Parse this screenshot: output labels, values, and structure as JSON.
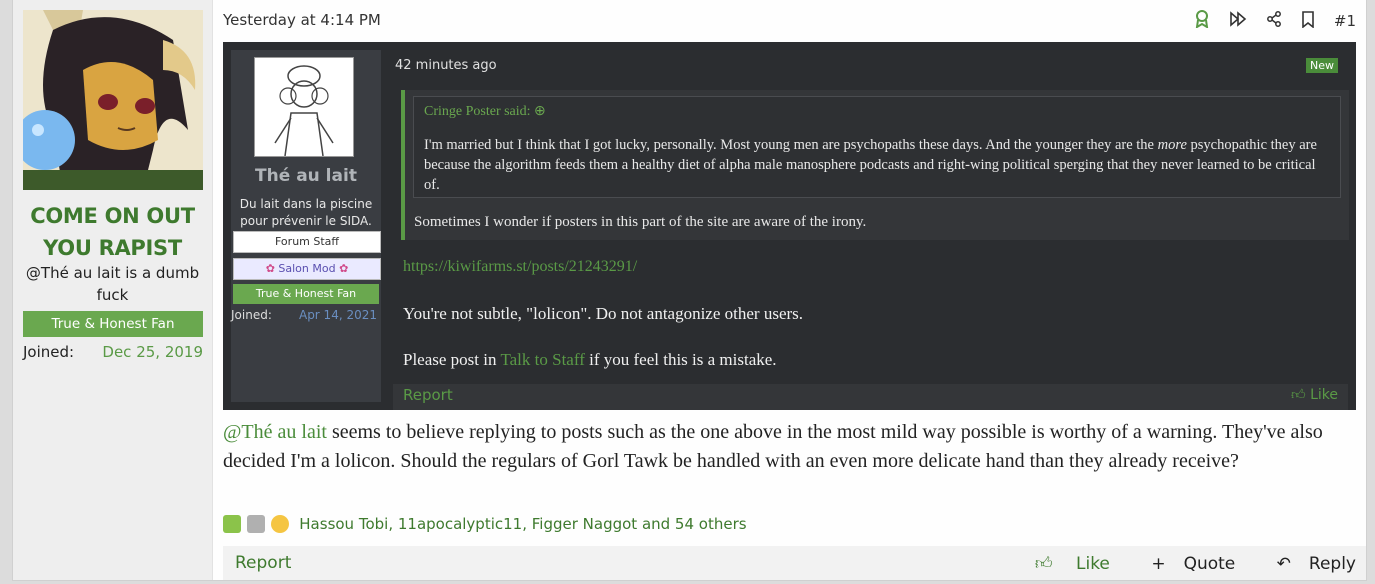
{
  "sidebar": {
    "username": "COME ON OUT YOU RAPIST",
    "user_title": "@Thé au lait is a dumb fuck",
    "banner": "True & Honest Fan",
    "joined_label": "Joined:",
    "joined_value": "Dec 25, 2019"
  },
  "header": {
    "timestamp": "Yesterday at 4:14 PM",
    "post_number": "#1"
  },
  "screenshot": {
    "time": "42 minutes ago",
    "badge": "New",
    "user": {
      "name": "Thé au lait",
      "title": "Du lait dans la piscine pour prévenir le SIDA.",
      "banners": [
        "Forum Staff",
        "Salon Mod",
        "True & Honest Fan"
      ],
      "joined_label": "Joined:",
      "joined_value": "Apr 14, 2021"
    },
    "quote_author": "Cringe Poster said:",
    "quote_text_1": "I'm married but I think that I got lucky, personally. Most young men are psychopaths these days. And the younger they are the ",
    "quote_text_em": "more",
    "quote_text_2": " psychopathic they are because the algorithm feeds them a healthy diet of alpha male manosphere podcasts and right-wing political sperging that they never learned to be critical of.",
    "after_quote": "Sometimes I wonder if posters in this part of the site are aware of the irony.",
    "link": "https://kiwifarms.st/posts/21243291/",
    "para1": "You're not subtle, \"lolicon\". Do not antagonize other users.",
    "para2_a": "Please post in ",
    "para2_link": "Talk to Staff",
    "para2_b": " if you feel this is a mistake.",
    "report": "Report",
    "like": "Like"
  },
  "body": {
    "mention": "@Thé au lait",
    "text": " seems to believe replying to posts such as the one above in the most mild way possible is worthy of a warning. They've also decided I'm a lolicon. Should the regulars of Gorl Tawk be handled with an even more delicate hand than they already receive?"
  },
  "reactions": {
    "names": "Hassou Tobi, 11apocalyptic11, Figger Naggot and 54 others"
  },
  "footer": {
    "report": "Report",
    "like": "Like",
    "quote": "Quote",
    "reply": "Reply"
  },
  "colors": {
    "accent": "#3e7a2e",
    "banner_green": "#6aa84f",
    "dark_bg": "#2b2d30"
  }
}
